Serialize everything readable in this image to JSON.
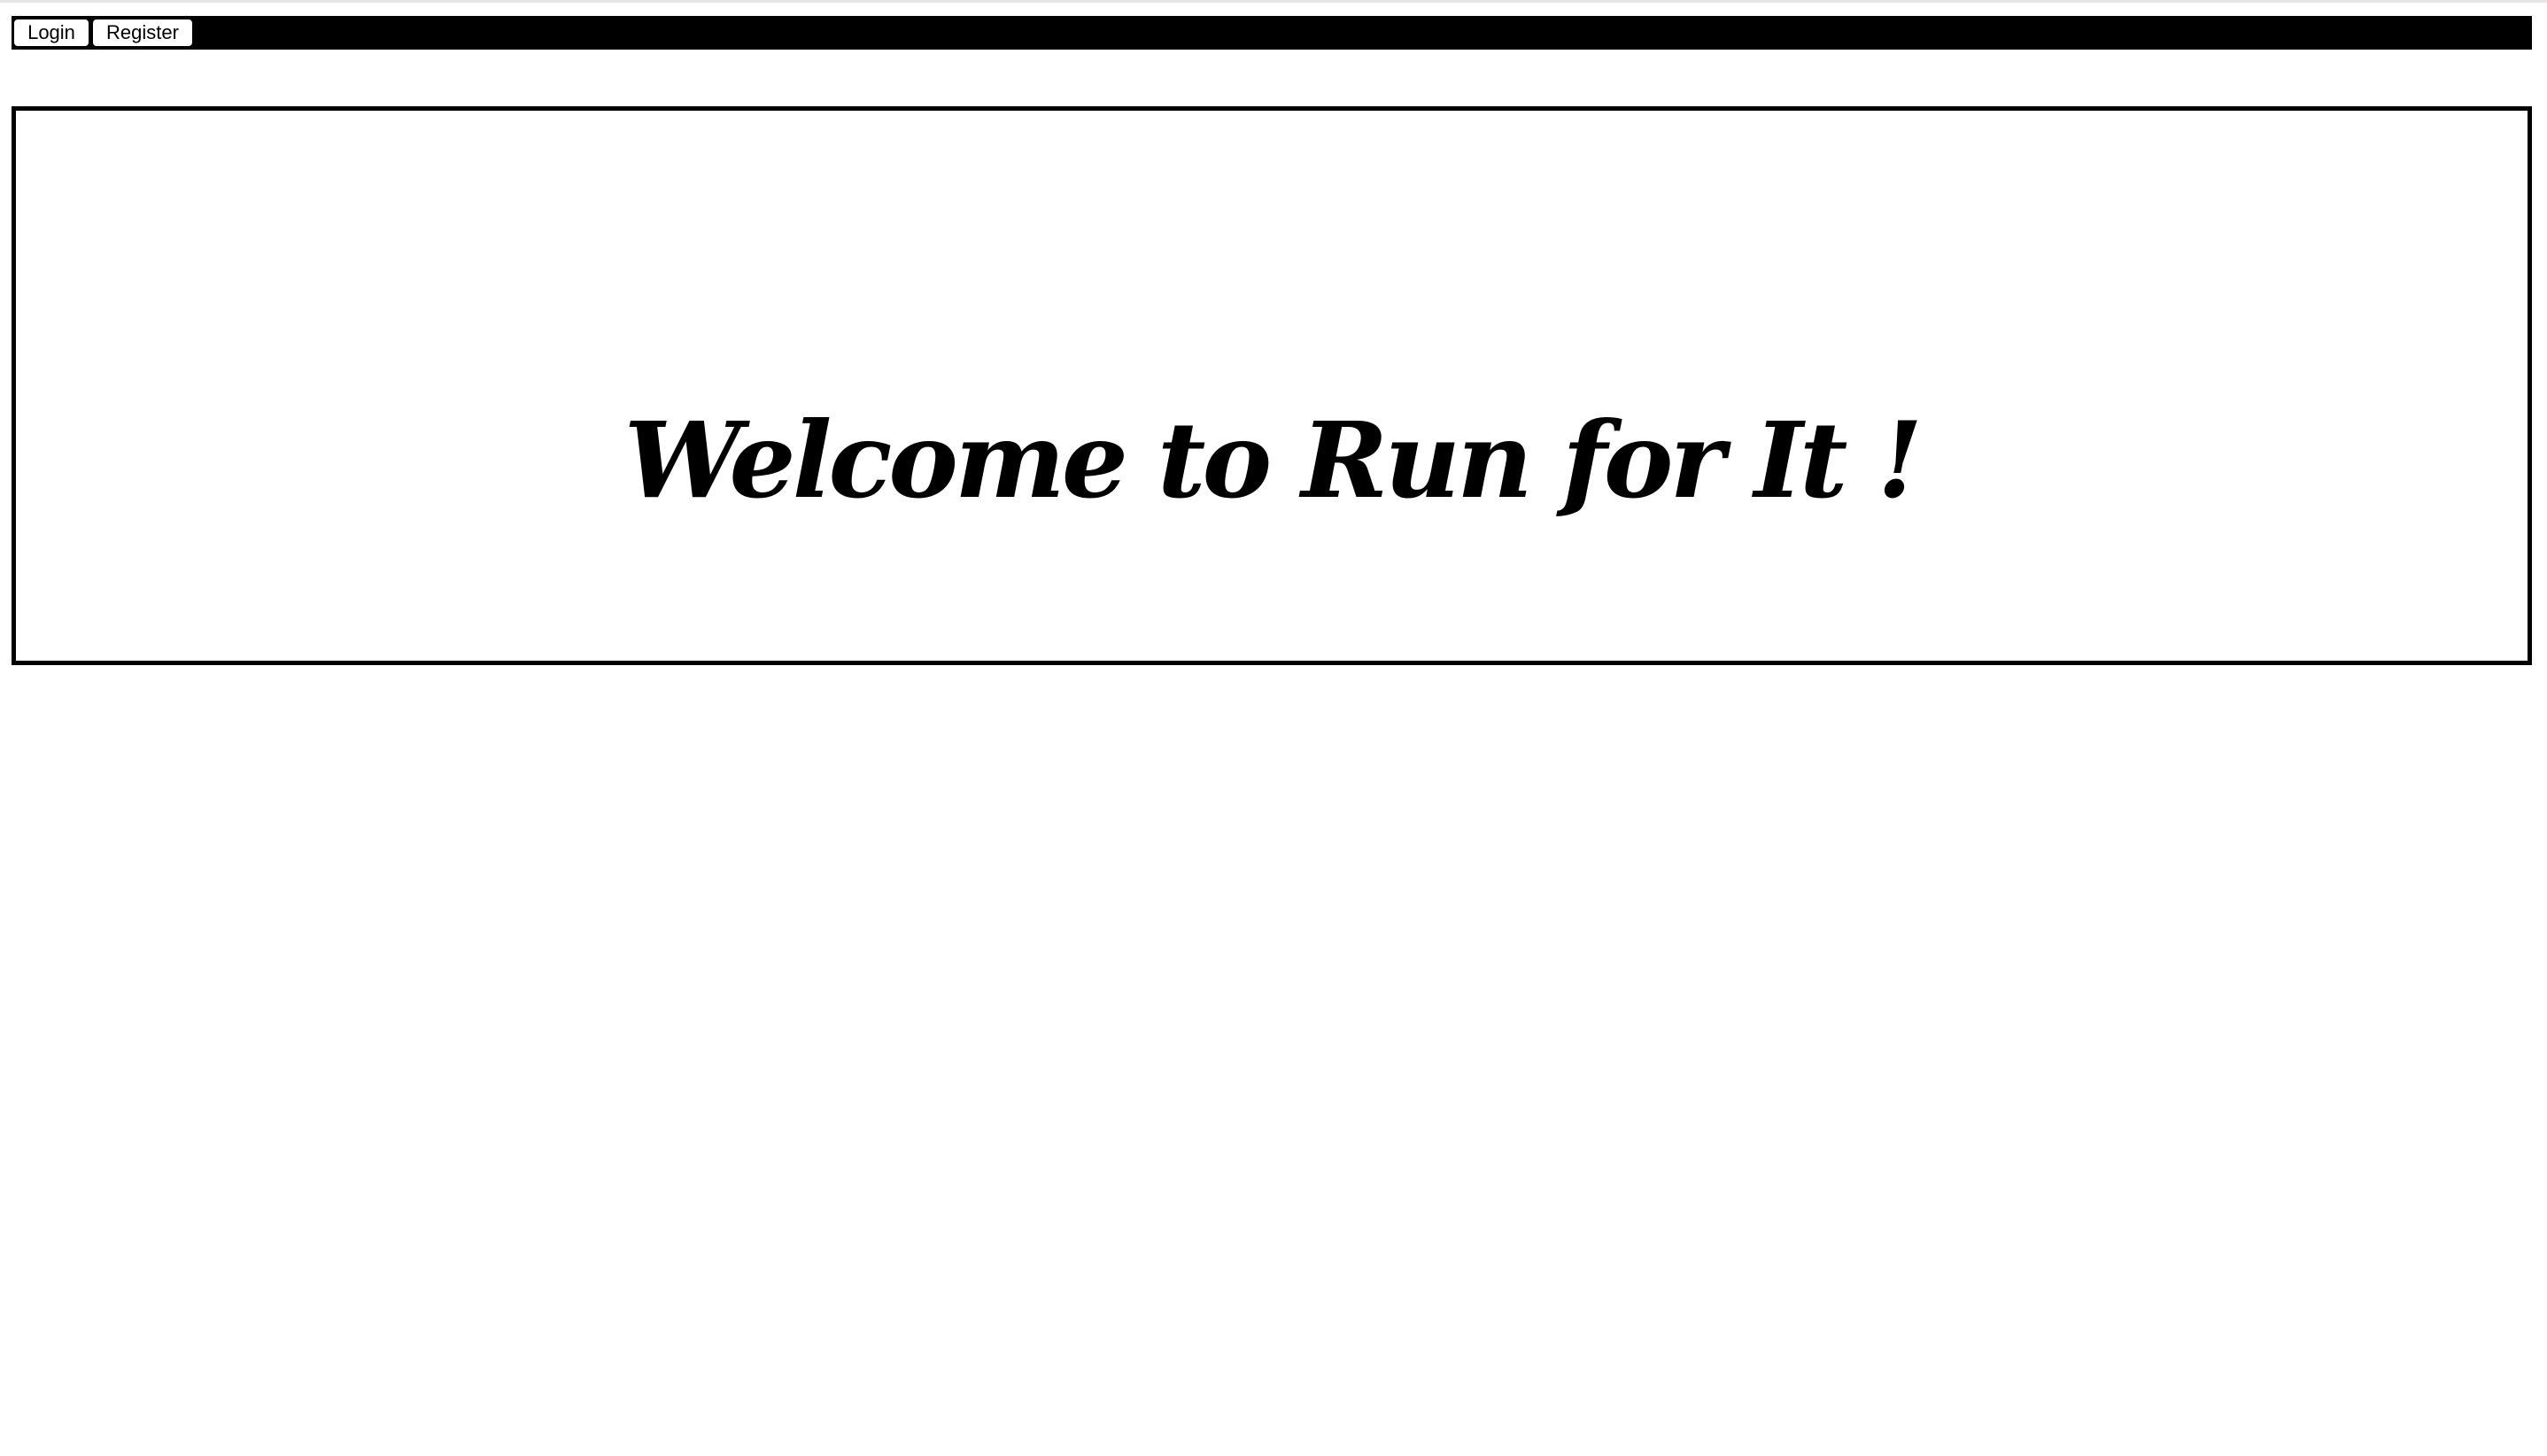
{
  "nav": {
    "login_label": "Login",
    "register_label": "Register"
  },
  "hero": {
    "title": "Welcome to Run for It !"
  },
  "colors": {
    "nav_background": "#000000",
    "hero_border": "#000000",
    "page_background": "#ffffff"
  }
}
